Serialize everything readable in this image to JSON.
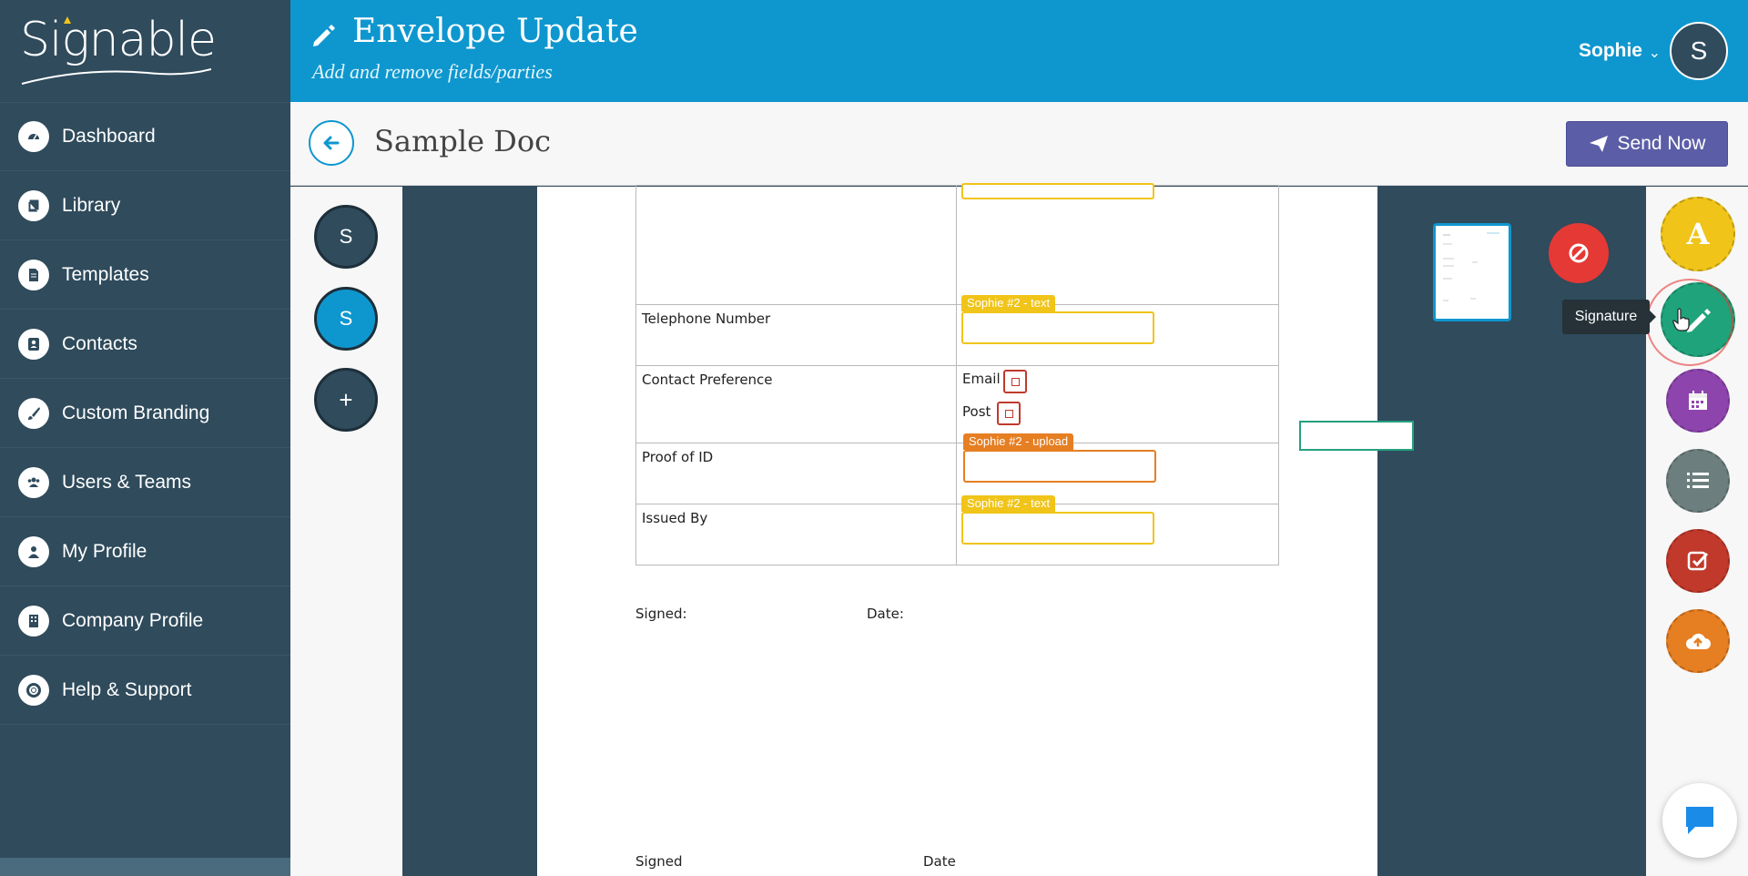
{
  "app": {
    "brand": "Signable"
  },
  "sidebar": {
    "items": [
      {
        "label": "Dashboard",
        "icon": "dashboard-icon"
      },
      {
        "label": "Library",
        "icon": "book-icon"
      },
      {
        "label": "Templates",
        "icon": "document-icon"
      },
      {
        "label": "Contacts",
        "icon": "contact-icon"
      },
      {
        "label": "Custom Branding",
        "icon": "brush-icon"
      },
      {
        "label": "Users & Teams",
        "icon": "users-icon"
      },
      {
        "label": "My Profile",
        "icon": "user-icon"
      },
      {
        "label": "Company Profile",
        "icon": "building-icon"
      },
      {
        "label": "Help & Support",
        "icon": "lifebuoy-icon"
      }
    ]
  },
  "header": {
    "title": "Envelope Update",
    "subtitle": "Add and remove fields/parties",
    "user_name": "Sophie",
    "user_initial": "S"
  },
  "subheader": {
    "doc_title": "Sample Doc",
    "send_label": "Send Now"
  },
  "parties": [
    {
      "initial": "S",
      "color": "#2f4b5c"
    },
    {
      "initial": "S",
      "color": "#0e97cf"
    },
    {
      "initial": "+",
      "color": "#2f4b5c"
    }
  ],
  "document": {
    "rows": [
      {
        "label": "Telephone Number"
      },
      {
        "label": "Contact Preference"
      },
      {
        "label": "Proof of ID"
      },
      {
        "label": "Issued By"
      }
    ],
    "options": {
      "email": "Email",
      "post": "Post"
    },
    "tags": {
      "telephone": "Sophie #2 - text",
      "proof": "Sophie #2 - upload",
      "issued": "Sophie #2 - text"
    },
    "signed1": "Signed:",
    "date1": "Date:",
    "signed2": "Signed",
    "date2": "Date"
  },
  "tools": {
    "text_letter": "A",
    "tooltip": "Signature"
  },
  "colors": {
    "sidebar": "#2f4b5c",
    "header": "#0e97cf",
    "send": "#5b5ea6",
    "text_field": "#f0c419",
    "upload_field": "#e67e22",
    "signature_tool": "#1fa37a",
    "date_tool": "#8e44ad",
    "list_tool": "#6c7f7e",
    "checkbox_tool": "#c0392b",
    "cancel": "#e53935"
  }
}
